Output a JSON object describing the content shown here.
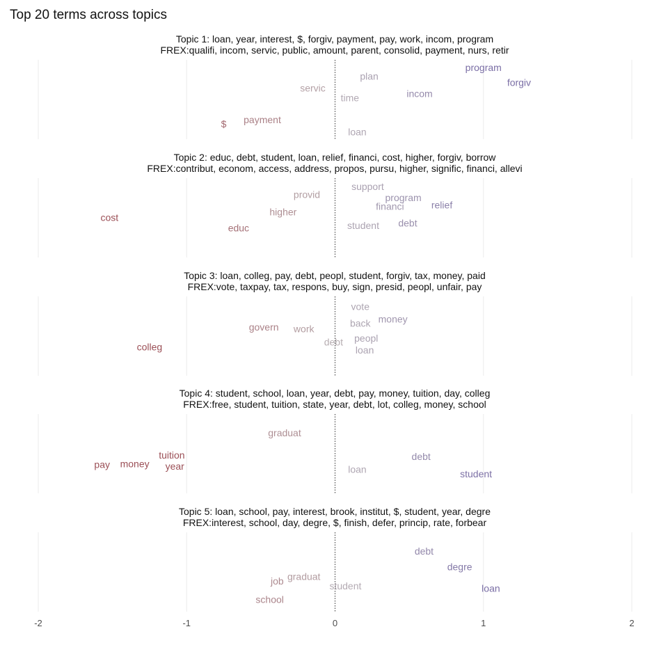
{
  "chart_data": {
    "type": "scatter",
    "title": "Top 20 terms across topics",
    "xlim": [
      -2,
      2
    ],
    "x_ticks": [
      "-2",
      "-1",
      "0",
      "1",
      "2"
    ],
    "grid": true,
    "legend": "none",
    "colors": {
      "negative": "#9b4f56",
      "neutral": "#b8b0b4",
      "positive": "#7a6ea5"
    },
    "panels": [
      {
        "title": "Topic 1: loan, year, interest, $, forgiv, payment, pay, work, incom, program",
        "subtitle": "FREX:qualifi, incom, servic, public, amount, parent, consolid, payment, nurs, retir",
        "terms": [
          {
            "label": "program",
            "x": 1.0,
            "y": 0.86
          },
          {
            "label": "forgiv",
            "x": 1.24,
            "y": 0.67
          },
          {
            "label": "plan",
            "x": 0.23,
            "y": 0.75
          },
          {
            "label": "servic",
            "x": -0.15,
            "y": 0.6
          },
          {
            "label": "incom",
            "x": 0.57,
            "y": 0.53
          },
          {
            "label": "time",
            "x": 0.1,
            "y": 0.48
          },
          {
            "label": "payment",
            "x": -0.49,
            "y": 0.2
          },
          {
            "label": "$",
            "x": -0.75,
            "y": 0.15
          },
          {
            "label": "loan",
            "x": 0.15,
            "y": 0.05
          }
        ]
      },
      {
        "title": "Topic 2: educ, debt, student, loan, relief, financi, cost, higher, forgiv, borrow",
        "subtitle": "FREX:contribut, econom, access, address, propos, pursu, higher, signific, financi, allevi",
        "terms": [
          {
            "label": "support",
            "x": 0.22,
            "y": 0.85
          },
          {
            "label": "provid",
            "x": -0.19,
            "y": 0.75
          },
          {
            "label": "program",
            "x": 0.46,
            "y": 0.71
          },
          {
            "label": "relief",
            "x": 0.72,
            "y": 0.62
          },
          {
            "label": "financi",
            "x": 0.37,
            "y": 0.6
          },
          {
            "label": "higher",
            "x": -0.35,
            "y": 0.53
          },
          {
            "label": "cost",
            "x": -1.52,
            "y": 0.46
          },
          {
            "label": "debt",
            "x": 0.49,
            "y": 0.39
          },
          {
            "label": "student",
            "x": 0.19,
            "y": 0.36
          },
          {
            "label": "educ",
            "x": -0.65,
            "y": 0.33
          }
        ]
      },
      {
        "title": "Topic 3: loan, colleg, pay, debt, peopl, student, forgiv, tax, money, paid",
        "subtitle": "FREX:vote, taxpay, tax, respons, buy, sign, presid, peopl, unfair, pay",
        "terms": [
          {
            "label": "vote",
            "x": 0.17,
            "y": 0.83
          },
          {
            "label": "money",
            "x": 0.39,
            "y": 0.67
          },
          {
            "label": "back",
            "x": 0.17,
            "y": 0.62
          },
          {
            "label": "govern",
            "x": -0.48,
            "y": 0.57
          },
          {
            "label": "work",
            "x": -0.21,
            "y": 0.55
          },
          {
            "label": "peopl",
            "x": 0.21,
            "y": 0.43
          },
          {
            "label": "debt",
            "x": -0.01,
            "y": 0.38
          },
          {
            "label": "colleg",
            "x": -1.25,
            "y": 0.32
          },
          {
            "label": "loan",
            "x": 0.2,
            "y": 0.28
          }
        ]
      },
      {
        "title": "Topic 4: student, school, loan, year, debt, pay, money, tuition, day, colleg",
        "subtitle": "FREX:free, student, tuition, state, year, debt, lot, colleg, money, school",
        "terms": [
          {
            "label": "graduat",
            "x": -0.34,
            "y": 0.72
          },
          {
            "label": "tuition",
            "x": -1.1,
            "y": 0.44
          },
          {
            "label": "debt",
            "x": 0.58,
            "y": 0.42
          },
          {
            "label": "money",
            "x": -1.35,
            "y": 0.33
          },
          {
            "label": "year",
            "x": -1.08,
            "y": 0.3
          },
          {
            "label": "pay",
            "x": -1.57,
            "y": 0.32
          },
          {
            "label": "loan",
            "x": 0.15,
            "y": 0.26
          },
          {
            "label": "student",
            "x": 0.95,
            "y": 0.2
          }
        ]
      },
      {
        "title": "Topic 5: loan, school, pay, interest, brook, institut, $, student, year, degre",
        "subtitle": "FREX:interest, school, day, degre, $, finish, defer, princip, rate, forbear",
        "terms": [
          {
            "label": "debt",
            "x": 0.6,
            "y": 0.72
          },
          {
            "label": "degre",
            "x": 0.84,
            "y": 0.52
          },
          {
            "label": "graduat",
            "x": -0.21,
            "y": 0.4
          },
          {
            "label": "job",
            "x": -0.39,
            "y": 0.34
          },
          {
            "label": "student",
            "x": 0.07,
            "y": 0.28
          },
          {
            "label": "loan",
            "x": 1.05,
            "y": 0.25
          },
          {
            "label": "school",
            "x": -0.44,
            "y": 0.11
          }
        ]
      }
    ]
  }
}
